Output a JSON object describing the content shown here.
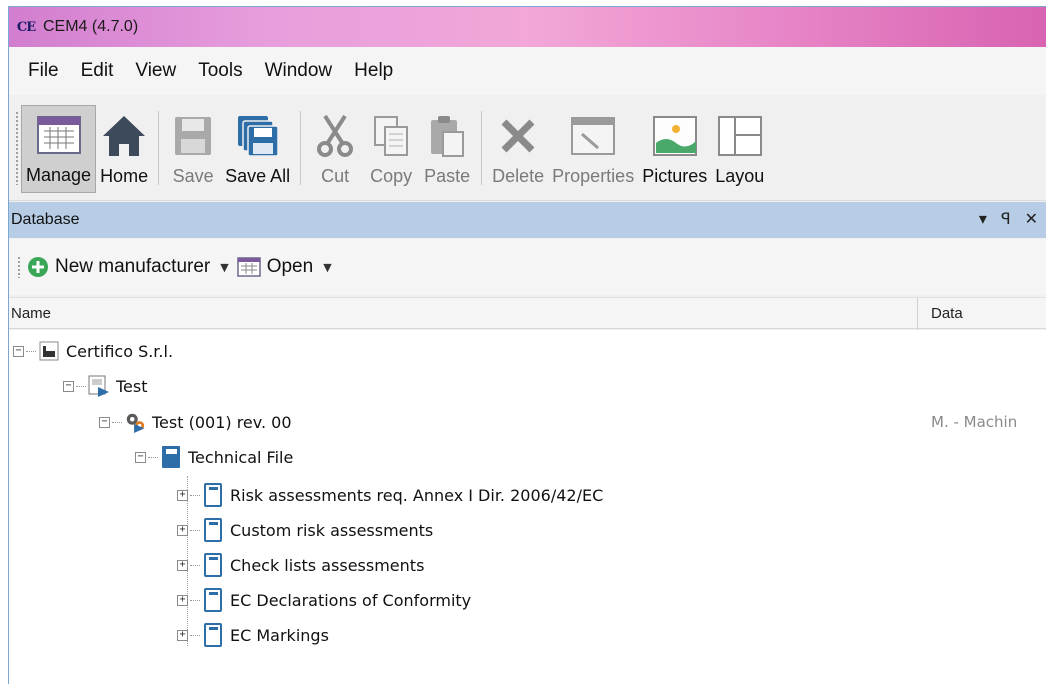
{
  "window": {
    "title": "CEM4 (4.7.0)",
    "app_icon": "CE"
  },
  "menu": [
    "File",
    "Edit",
    "View",
    "Tools",
    "Window",
    "Help"
  ],
  "toolbar": {
    "manage": "Manage",
    "home": "Home",
    "save": "Save",
    "save_all": "Save All",
    "cut": "Cut",
    "copy": "Copy",
    "paste": "Paste",
    "delete": "Delete",
    "properties": "Properties",
    "pictures": "Pictures",
    "layout": "Layou"
  },
  "panel": {
    "title": "Database",
    "dropdown_icon": "▾",
    "pin_icon": "ꟼ",
    "close_icon": "✕"
  },
  "subtoolbar": {
    "new_manufacturer": "New manufacturer",
    "open": "Open"
  },
  "columns": {
    "name": "Name",
    "data": "Data"
  },
  "tree": {
    "manufacturer": "Certifico S.r.l.",
    "project": "Test",
    "machine": "Test (001) rev. 00",
    "machine_data": "M. - Machin",
    "technical_file": "Technical File",
    "children": [
      "Risk assessments req. Annex I Dir. 2006/42/EC",
      "Custom risk assessments",
      "Check lists assessments",
      "EC Declarations of Conformity",
      "EC Markings"
    ]
  },
  "colors": {
    "panel_header": "#b7cde6",
    "title_gradient_start": "#d27dcf",
    "title_gradient_end": "#d863b2",
    "accent_blue": "#2d6da8"
  }
}
